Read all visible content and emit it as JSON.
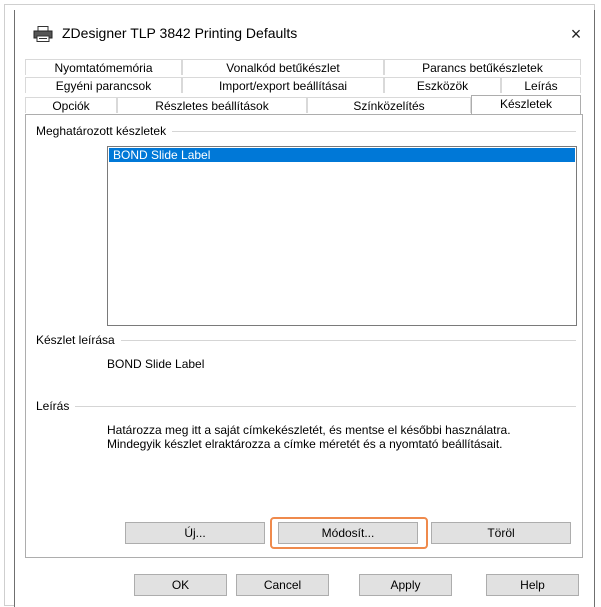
{
  "window": {
    "title": "ZDesigner TLP 3842 Printing Defaults",
    "close_symbol": "×"
  },
  "tabs": {
    "row1": [
      "Nyomtatómemória",
      "Vonalkód betűkészlet",
      "Parancs betűkészletek"
    ],
    "row2": [
      "Egyéni parancsok",
      "Import/export beállításai",
      "Eszközök",
      "Leírás"
    ],
    "row3": [
      "Opciók",
      "Részletes beállítások",
      "Színközelítés",
      "Készletek"
    ],
    "active": "Készletek"
  },
  "defined_sets": {
    "label": "Meghatározott készletek",
    "items": [
      "BOND Slide Label"
    ]
  },
  "set_description": {
    "label": "Készlet leírása",
    "value": "BOND Slide Label"
  },
  "description": {
    "label": "Leírás",
    "text": "Határozza meg itt a saját címkekészletét, és mentse el későbbi használatra. Mindegyik készlet elraktározza a címke méretét és a nyomtató beállításait."
  },
  "set_buttons": {
    "new": "Új...",
    "modify": "Módosít...",
    "delete": "Töröl"
  },
  "dialog_buttons": {
    "ok": "OK",
    "cancel": "Cancel",
    "apply": "Apply",
    "help": "Help"
  },
  "colors": {
    "selection": "#0078d7",
    "highlight_outline": "#ef8a4c"
  }
}
